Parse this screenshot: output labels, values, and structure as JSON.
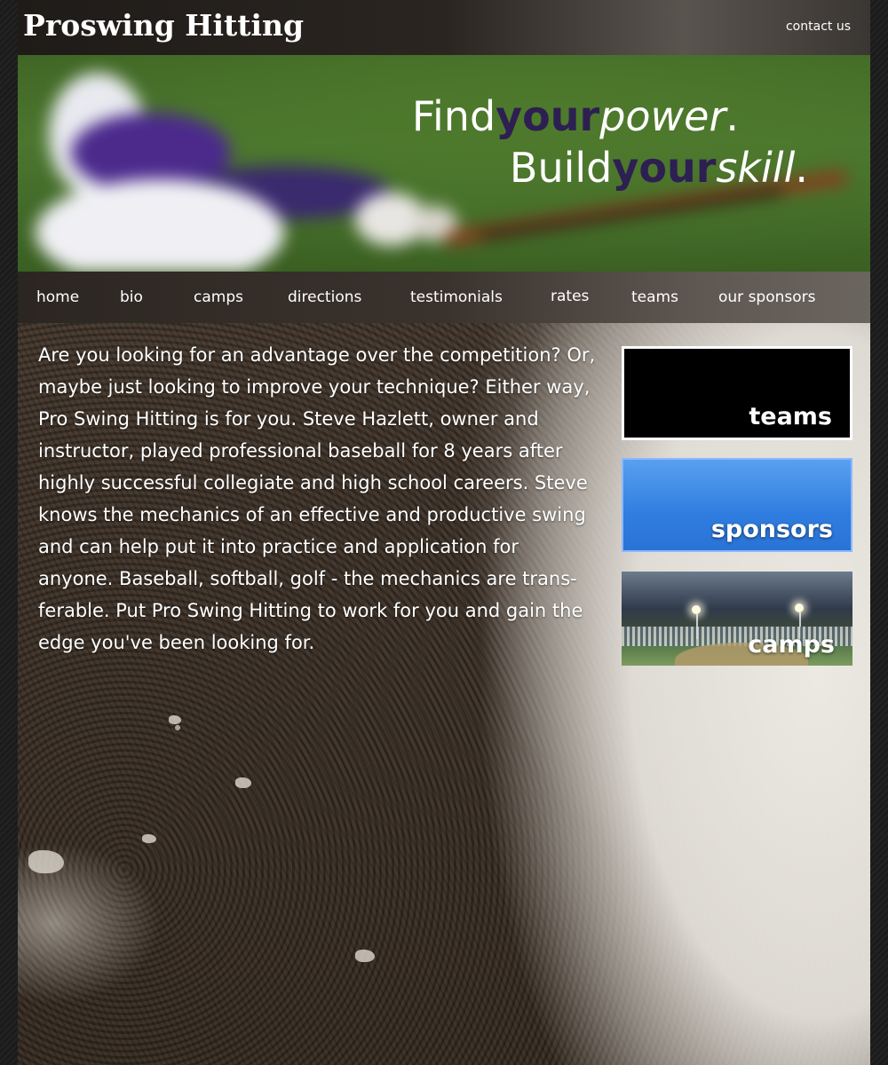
{
  "header": {
    "logo": "Proswing Hitting",
    "contact": "contact us"
  },
  "hero": {
    "line1": {
      "a": "Find",
      "b": "your",
      "c": "power",
      "d": "."
    },
    "line2": {
      "a": "Build",
      "b": "your",
      "c": "skill",
      "d": "."
    }
  },
  "nav": {
    "items": [
      {
        "label": "home"
      },
      {
        "label": "bio"
      },
      {
        "label": "camps"
      },
      {
        "label": "directions"
      },
      {
        "label": "testimonials"
      },
      {
        "label": "rates"
      },
      {
        "label": "teams"
      },
      {
        "label": "our sponsors"
      }
    ]
  },
  "main": {
    "intro": "Are you looking for an advantage over the competition? Or, maybe just looking to improve your technique? Either way, Pro Swing Hitting is for you. Steve Hazlett, owner and instructor, played professional baseball for 8 years after highly successful collegiate and high school careers. Steve knows the mechanics of an effective and productive swing and can help put it into practice and application for anyone. Baseball, softball, golf - the mechanics are trans-ferable. Put Pro Swing Hitting to work for you and gain the edge you've been looking for."
  },
  "sidebar": {
    "teams": "teams",
    "sponsors": "sponsors",
    "camps": "camps"
  },
  "colors": {
    "accent_purple": "#2d1f52",
    "sponsors_blue": "#2f7de0"
  }
}
